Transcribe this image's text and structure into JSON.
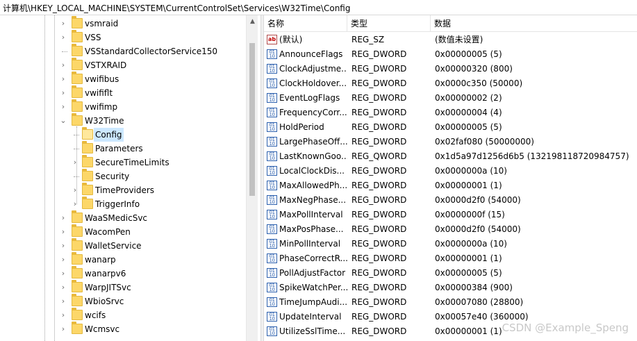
{
  "address_bar": {
    "path": "计算机\\HKEY_LOCAL_MACHINE\\SYSTEM\\CurrentControlSet\\Services\\W32Time\\Config"
  },
  "tree": {
    "items": [
      {
        "label": "vsmraid",
        "level": 0,
        "expander": "collapsed"
      },
      {
        "label": "VSS",
        "level": 0,
        "expander": "collapsed"
      },
      {
        "label": "VSStandardCollectorService150",
        "level": 0,
        "expander": "none"
      },
      {
        "label": "VSTXRAID",
        "level": 0,
        "expander": "collapsed"
      },
      {
        "label": "vwifibus",
        "level": 0,
        "expander": "collapsed"
      },
      {
        "label": "vwififlt",
        "level": 0,
        "expander": "collapsed"
      },
      {
        "label": "vwifimp",
        "level": 0,
        "expander": "collapsed"
      },
      {
        "label": "W32Time",
        "level": 0,
        "expander": "expanded"
      },
      {
        "label": "Config",
        "level": 1,
        "expander": "none",
        "selected": true
      },
      {
        "label": "Parameters",
        "level": 1,
        "expander": "none"
      },
      {
        "label": "SecureTimeLimits",
        "level": 1,
        "expander": "collapsed"
      },
      {
        "label": "Security",
        "level": 1,
        "expander": "none"
      },
      {
        "label": "TimeProviders",
        "level": 1,
        "expander": "collapsed"
      },
      {
        "label": "TriggerInfo",
        "level": 1,
        "expander": "collapsed"
      },
      {
        "label": "WaaSMedicSvc",
        "level": 0,
        "expander": "collapsed"
      },
      {
        "label": "WacomPen",
        "level": 0,
        "expander": "collapsed"
      },
      {
        "label": "WalletService",
        "level": 0,
        "expander": "collapsed"
      },
      {
        "label": "wanarp",
        "level": 0,
        "expander": "collapsed"
      },
      {
        "label": "wanarpv6",
        "level": 0,
        "expander": "collapsed"
      },
      {
        "label": "WarpJITSvc",
        "level": 0,
        "expander": "collapsed"
      },
      {
        "label": "WbioSrvc",
        "level": 0,
        "expander": "collapsed"
      },
      {
        "label": "wcifs",
        "level": 0,
        "expander": "collapsed"
      },
      {
        "label": "Wcmsvc",
        "level": 0,
        "expander": "collapsed"
      }
    ]
  },
  "values": {
    "headers": {
      "name": "名称",
      "type": "类型",
      "data": "数据"
    },
    "rows": [
      {
        "icon": "string-value-icon",
        "name": "(默认)",
        "type": "REG_SZ",
        "data": "(数值未设置)"
      },
      {
        "icon": "binary-value-icon",
        "name": "AnnounceFlags",
        "type": "REG_DWORD",
        "data": "0x00000005 (5)"
      },
      {
        "icon": "binary-value-icon",
        "name": "ClockAdjustme...",
        "type": "REG_DWORD",
        "data": "0x00000320 (800)"
      },
      {
        "icon": "binary-value-icon",
        "name": "ClockHoldover...",
        "type": "REG_DWORD",
        "data": "0x0000c350 (50000)"
      },
      {
        "icon": "binary-value-icon",
        "name": "EventLogFlags",
        "type": "REG_DWORD",
        "data": "0x00000002 (2)"
      },
      {
        "icon": "binary-value-icon",
        "name": "FrequencyCorr...",
        "type": "REG_DWORD",
        "data": "0x00000004 (4)"
      },
      {
        "icon": "binary-value-icon",
        "name": "HoldPeriod",
        "type": "REG_DWORD",
        "data": "0x00000005 (5)"
      },
      {
        "icon": "binary-value-icon",
        "name": "LargePhaseOff...",
        "type": "REG_DWORD",
        "data": "0x02faf080 (50000000)"
      },
      {
        "icon": "binary-value-icon",
        "name": "LastKnownGoo...",
        "type": "REG_QWORD",
        "data": "0x1d5a97d1256d6b5 (132198118720984757)"
      },
      {
        "icon": "binary-value-icon",
        "name": "LocalClockDis...",
        "type": "REG_DWORD",
        "data": "0x0000000a (10)"
      },
      {
        "icon": "binary-value-icon",
        "name": "MaxAllowedPh...",
        "type": "REG_DWORD",
        "data": "0x00000001 (1)"
      },
      {
        "icon": "binary-value-icon",
        "name": "MaxNegPhase...",
        "type": "REG_DWORD",
        "data": "0x0000d2f0 (54000)"
      },
      {
        "icon": "binary-value-icon",
        "name": "MaxPollInterval",
        "type": "REG_DWORD",
        "data": "0x0000000f (15)"
      },
      {
        "icon": "binary-value-icon",
        "name": "MaxPosPhase...",
        "type": "REG_DWORD",
        "data": "0x0000d2f0 (54000)"
      },
      {
        "icon": "binary-value-icon",
        "name": "MinPollInterval",
        "type": "REG_DWORD",
        "data": "0x0000000a (10)"
      },
      {
        "icon": "binary-value-icon",
        "name": "PhaseCorrectR...",
        "type": "REG_DWORD",
        "data": "0x00000001 (1)"
      },
      {
        "icon": "binary-value-icon",
        "name": "PollAdjustFactor",
        "type": "REG_DWORD",
        "data": "0x00000005 (5)"
      },
      {
        "icon": "binary-value-icon",
        "name": "SpikeWatchPer...",
        "type": "REG_DWORD",
        "data": "0x00000384 (900)"
      },
      {
        "icon": "binary-value-icon",
        "name": "TimeJumpAudi...",
        "type": "REG_DWORD",
        "data": "0x00007080 (28800)"
      },
      {
        "icon": "binary-value-icon",
        "name": "UpdateInterval",
        "type": "REG_DWORD",
        "data": "0x00057e40 (360000)"
      },
      {
        "icon": "binary-value-icon",
        "name": "UtilizeSslTime...",
        "type": "REG_DWORD",
        "data": "0x00000001 (1)"
      }
    ]
  },
  "watermark": "CSDN @Example_Speng"
}
